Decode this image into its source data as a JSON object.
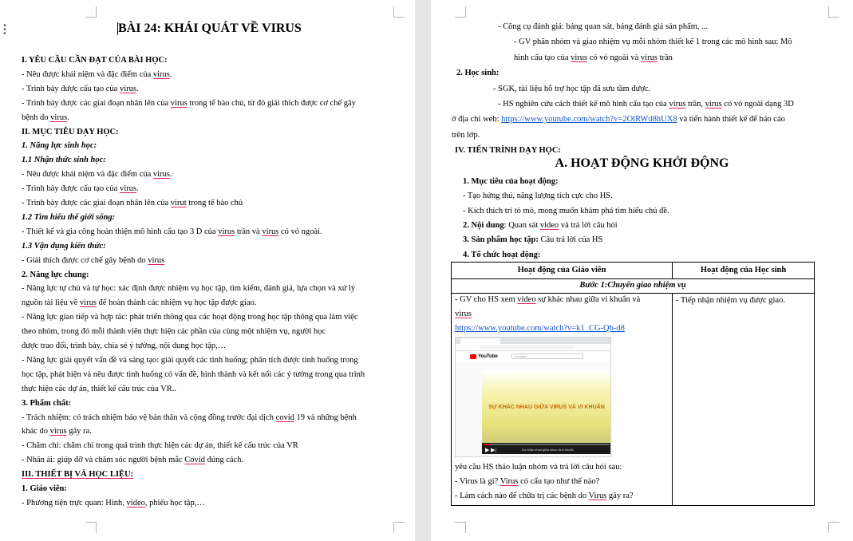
{
  "left": {
    "title": "BÀI 24: KHÁI QUÁT VỀ VIRUS",
    "lines": [
      [
        {
          "t": "I. YÊU CẦU CẦN ĐẠT CỦA BÀI HỌC:",
          "s": "b"
        }
      ],
      [
        {
          "t": "- Nêu được khái niệm và đặc điểm của "
        },
        {
          "t": "virus",
          "s": "u"
        },
        {
          "t": "."
        }
      ],
      [
        {
          "t": "- Trình bày được cấu tạo của "
        },
        {
          "t": "virus",
          "s": "u"
        },
        {
          "t": "."
        }
      ],
      [
        {
          "t": "- Trình bày được các giai đoạn nhân lên của "
        },
        {
          "t": "virus",
          "s": "u"
        },
        {
          "t": " trong tế bào chủ, từ đó giải thích được cơ chế gây"
        }
      ],
      [
        {
          "t": "bệnh do "
        },
        {
          "t": "virus",
          "s": "u"
        },
        {
          "t": "."
        }
      ],
      [
        {
          "t": "II. MỤC TIÊU DẠY HỌC:",
          "s": "b"
        }
      ],
      [
        {
          "t": "1. Năng lực sinh học:",
          "s": "bi"
        }
      ],
      [
        {
          "t": "1.1 Nhận thức sinh học:",
          "s": "bi"
        }
      ],
      [
        {
          "t": "- Nêu được khái niệm và đặc điểm của "
        },
        {
          "t": "virus",
          "s": "u"
        },
        {
          "t": "."
        }
      ],
      [
        {
          "t": "- Trình bày được cấu tạo của "
        },
        {
          "t": "virus",
          "s": "u"
        },
        {
          "t": "."
        }
      ],
      [
        {
          "t": "- Trình bày được các giai đoạn nhân lên của "
        },
        {
          "t": "virut",
          "s": "u"
        },
        {
          "t": " trong tế bào chủ"
        }
      ],
      [
        {
          "t": "1.2 Tìm hiểu thế giới sống:",
          "s": "bi"
        }
      ],
      [
        {
          "t": "- Thiết kế và gia công hoàn thiện mô hình cấu tạo 3 D của "
        },
        {
          "t": "virus",
          "s": "u"
        },
        {
          "t": " trần và "
        },
        {
          "t": "virus",
          "s": "u"
        },
        {
          "t": " có vỏ ngoài."
        }
      ],
      [
        {
          "t": "1.3 Vận dụng kiến thức:",
          "s": "bi"
        }
      ],
      [
        {
          "t": "- Giải thích được cơ chế gây bệnh do "
        },
        {
          "t": "virus",
          "s": "u"
        }
      ],
      [
        {
          "t": "2. Năng lực chung:",
          "s": "b"
        }
      ],
      [
        {
          "t": " - Năng lực tự chủ và tự học: xác định được nhiệm vụ học tập, tìm kiếm, đánh giá, lựa chọn và xử lý"
        }
      ],
      [
        {
          "t": " nguồn tài liệu về "
        },
        {
          "t": "virus",
          "s": "u"
        },
        {
          "t": " để hoàn thành các nhiệm vụ học tập được giao."
        }
      ],
      [
        {
          "t": "- Năng lực giao tiếp và hợp tác: phát triển thông qua các hoạt động trong học tập thông qua làm việc"
        }
      ],
      [
        {
          "t": "theo nhóm, trong đó mỗi thành viên thực hiện các phần của cùng một nhiệm vụ, người học"
        }
      ],
      [
        {
          "t": "được trao đổi, trình bày, chia sẻ ý tưởng, nội dung học tập,…"
        }
      ],
      [
        {
          "t": "- Năng lực giải quyết vấn đề và sáng tạo: giải quyết các tình huống; phân tích được tình huống trong"
        }
      ],
      [
        {
          "t": "học tập, phát hiện và nêu được tình huống có vấn đề, hình thành và kết nối các ý tưởng trong qua trình"
        }
      ],
      [
        {
          "t": "thực hiện các dự án, thiết kế cấu trúc của VR.."
        }
      ],
      [
        {
          "t": "3. Phẩm chất:",
          "s": "b"
        }
      ],
      [
        {
          "t": "- Trách nhiệm: có trách nhiệm bảo vệ bản thân và cộng đồng trước đại dịch "
        },
        {
          "t": "covid",
          "s": "u"
        },
        {
          "t": " 19 và những bệnh"
        }
      ],
      [
        {
          "t": "khác do "
        },
        {
          "t": "virus",
          "s": "u"
        },
        {
          "t": " gây ra."
        }
      ],
      [
        {
          "t": "- Chăm chỉ: chăm chỉ trong quá trình thực hiện các dự án, thiết kế cấu trúc của VR"
        }
      ],
      [
        {
          "t": "- Nhân ái: giúp đỡ và chăm sóc người bệnh mắc "
        },
        {
          "t": "Covid",
          "s": "u"
        },
        {
          "t": " đúng cách."
        }
      ],
      [
        {
          "t": "III. THIẾT BỊ VÀ HỌC LIỆU:",
          "s": "bu"
        }
      ],
      [
        {
          "t": " 1. Giáo viên:",
          "s": "b"
        }
      ],
      [
        {
          "t": "            - Phương tiện trực quan: Hình, "
        },
        {
          "t": "video",
          "s": "u"
        },
        {
          "t": ", phiếu học tập,…"
        }
      ]
    ]
  },
  "right": {
    "lines_top": [
      [
        {
          "t": "- Công cụ đánh giá: bảng quan sát, bảng đánh giá sản phẩm, ..."
        }
      ],
      [
        {
          "t": "- GV phân nhóm và giao nhiệm vụ mỗi nhóm thiết kế 1 trong các mô hình sau: Mô"
        }
      ],
      [
        {
          "t": "hình cấu tạo của "
        },
        {
          "t": "virus",
          "s": "u"
        },
        {
          "t": " có vỏ ngoài và "
        },
        {
          "t": "virus",
          "s": "u"
        },
        {
          "t": " trần"
        }
      ],
      [
        {
          "t": "2. Học sinh:",
          "s": "b"
        }
      ],
      [
        {
          "t": "- SGK, tài liệu hỗ trợ học tập đã sưu tầm được."
        }
      ],
      [
        {
          "t": "- HS nghiên cứu cách thiết kế mô hình cấu tạo của "
        },
        {
          "t": "virus",
          "s": "u"
        },
        {
          "t": " trần, "
        },
        {
          "t": "virus",
          "s": "u"
        },
        {
          "t": " có vỏ ngoài dạng 3D"
        }
      ],
      [
        {
          "t": "ở địa chỉ web: "
        },
        {
          "t": "https://www.youtube.com/watch?v=2OlRWd8hUX8",
          "s": "link"
        },
        {
          "t": " và tiến hành thiết kế để báo cáo"
        }
      ],
      [
        {
          "t": "trên lớp."
        }
      ],
      [
        {
          "t": "IV. TIẾN TRÌNH DẠY HỌC:",
          "s": "b"
        }
      ]
    ],
    "section_title": "A. HOẠT ĐỘNG KHỞI ĐỘNG",
    "lines_mid": [
      [
        {
          "t": "1. Mục tiêu của hoạt động:",
          "s": "b"
        }
      ],
      [
        {
          "t": "- Tạo hứng thú, năng lượng tích cực cho HS."
        }
      ],
      [
        {
          "t": "- Kích thích trí tò mò, mong muốn khám phá tìm hiểu chủ đề."
        }
      ],
      [
        {
          "t": "2. Nội dung",
          "s": "b"
        },
        {
          "t": ": Quan sát "
        },
        {
          "t": "video",
          "s": "u"
        },
        {
          "t": " và trả lời câu hỏi"
        }
      ],
      [
        {
          "t": "3. Sản phẩm học tập:",
          "s": "b"
        },
        {
          "t": " Câu trả lời của HS"
        }
      ],
      [
        {
          "t": "4. Tổ chức hoạt động:",
          "s": "b"
        }
      ]
    ],
    "table": {
      "header_teacher": "Hoạt động của Giáo viên",
      "header_student": "Hoạt động của Học sinh",
      "step": "Bước 1:Chuyển giao nhiệm vụ",
      "teacher_lines": [
        [
          {
            "t": "- GV cho HS xem "
          },
          {
            "t": "video",
            "s": "u"
          },
          {
            "t": " sự khác nhau giữa vi khuẩn và"
          }
        ],
        [
          {
            "t": "virus",
            "s": "u"
          }
        ],
        [
          {
            "t": "https://www.youtube.com/watch?v=k1_CG-Qh-d8",
            "s": "link"
          }
        ]
      ],
      "teacher_after": [
        [
          {
            "t": "yêu cầu HS thảo luận nhóm và trả lời câu hỏi sau:"
          }
        ],
        [
          {
            "t": "- Virus là gì? "
          },
          {
            "t": "Virus",
            "s": "u"
          },
          {
            "t": " có cấu tạo như thế nào?"
          }
        ],
        [
          {
            "t": "- Làm cách nào để chữa trị các bệnh do "
          },
          {
            "t": "Virus",
            "s": "u"
          },
          {
            "t": " gây ra?"
          }
        ]
      ],
      "student_text": "- Tiếp nhận nhiệm vụ được giao.",
      "video": {
        "title": "SỰ KHÁC NHAU GIỮA VIRUS VÀ VI KHUẨN",
        "site": "YouTube",
        "search_placeholder": "Tìm kiếm",
        "caption": "Sự khác nhau giữa virus và vi khuẩn"
      }
    }
  }
}
